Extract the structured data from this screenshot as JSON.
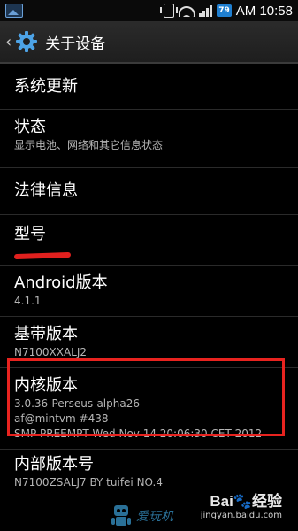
{
  "status_bar": {
    "battery_level": "79",
    "time": "AM 10:58"
  },
  "action_bar": {
    "back_glyph": "‹",
    "title": "关于设备"
  },
  "items": [
    {
      "title": "系统更新"
    },
    {
      "title": "状态",
      "subtitle": "显示电池、网络和其它信息状态"
    },
    {
      "title": "法律信息"
    },
    {
      "title": "型号"
    },
    {
      "title": "Android版本",
      "value": "4.1.1"
    },
    {
      "title": "基带版本",
      "value": "N7100XXALJ2"
    },
    {
      "title": "内核版本",
      "value_lines": [
        "3.0.36-Perseus-alpha26",
        "af@mintvm #438",
        "SMP PREEMPT Wed Nov 14 20:06:30 CET 2012"
      ]
    },
    {
      "title": "内部版本号",
      "value": "N7100ZSALJ7 BY tuifei NO.4"
    }
  ],
  "watermark": {
    "baidu_text": "Bai",
    "baidu_paw": "🐾",
    "baidu_suffix": "经验",
    "baidu_url": "jingyan.baidu.com",
    "bottom_text": "爱玩机"
  },
  "colors": {
    "highlight": "#e8231f",
    "redaction": "#e0201e",
    "accent_blue": "#1f7fd0"
  }
}
